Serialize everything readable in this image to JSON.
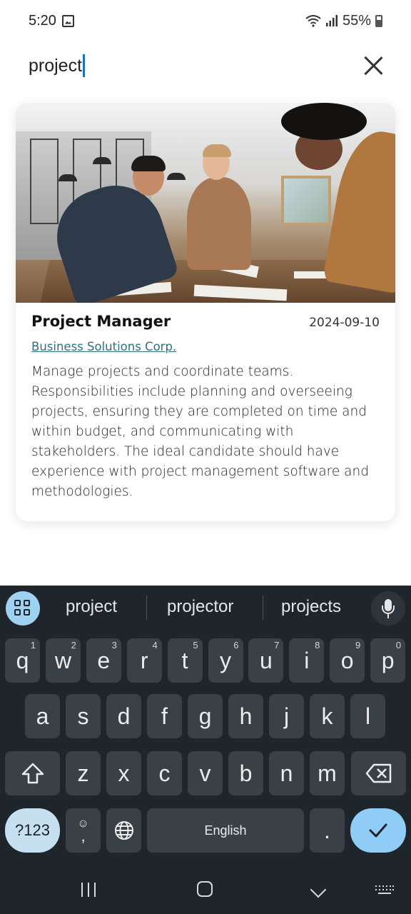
{
  "status_bar": {
    "time": "5:20",
    "battery": "55%",
    "icons": [
      "image-icon",
      "wifi-icon",
      "signal-icon",
      "battery-icon"
    ]
  },
  "search": {
    "value": "project",
    "clear_icon": "close-icon"
  },
  "result_card": {
    "title": "Project Manager",
    "date": "2024-09-10",
    "company": "Business Solutions Corp.",
    "description": "Manage projects and coordinate teams. Responsibilities include planning and overseeing projects, ensuring they are completed on time and within budget, and communicating with stakeholders. The ideal candidate should have experience with project management software and methodologies.",
    "image": "office-team-photo"
  },
  "keyboard": {
    "suggestions": [
      "project",
      "projector",
      "projects"
    ],
    "row1": [
      {
        "k": "q",
        "h": "1"
      },
      {
        "k": "w",
        "h": "2"
      },
      {
        "k": "e",
        "h": "3"
      },
      {
        "k": "r",
        "h": "4"
      },
      {
        "k": "t",
        "h": "5"
      },
      {
        "k": "y",
        "h": "6"
      },
      {
        "k": "u",
        "h": "7"
      },
      {
        "k": "i",
        "h": "8"
      },
      {
        "k": "o",
        "h": "9"
      },
      {
        "k": "p",
        "h": "0"
      }
    ],
    "row2": [
      "a",
      "s",
      "d",
      "f",
      "g",
      "h",
      "j",
      "k",
      "l"
    ],
    "row3": [
      "z",
      "x",
      "c",
      "v",
      "b",
      "n",
      "m"
    ],
    "symbols_label": "?123",
    "space_label": "English",
    "period_label": ".",
    "comma_label": ",",
    "colors": {
      "background": "#1f262b",
      "key": "#3a4146",
      "enter": "#8fcdf6",
      "symbols": "#c6dff1"
    }
  }
}
